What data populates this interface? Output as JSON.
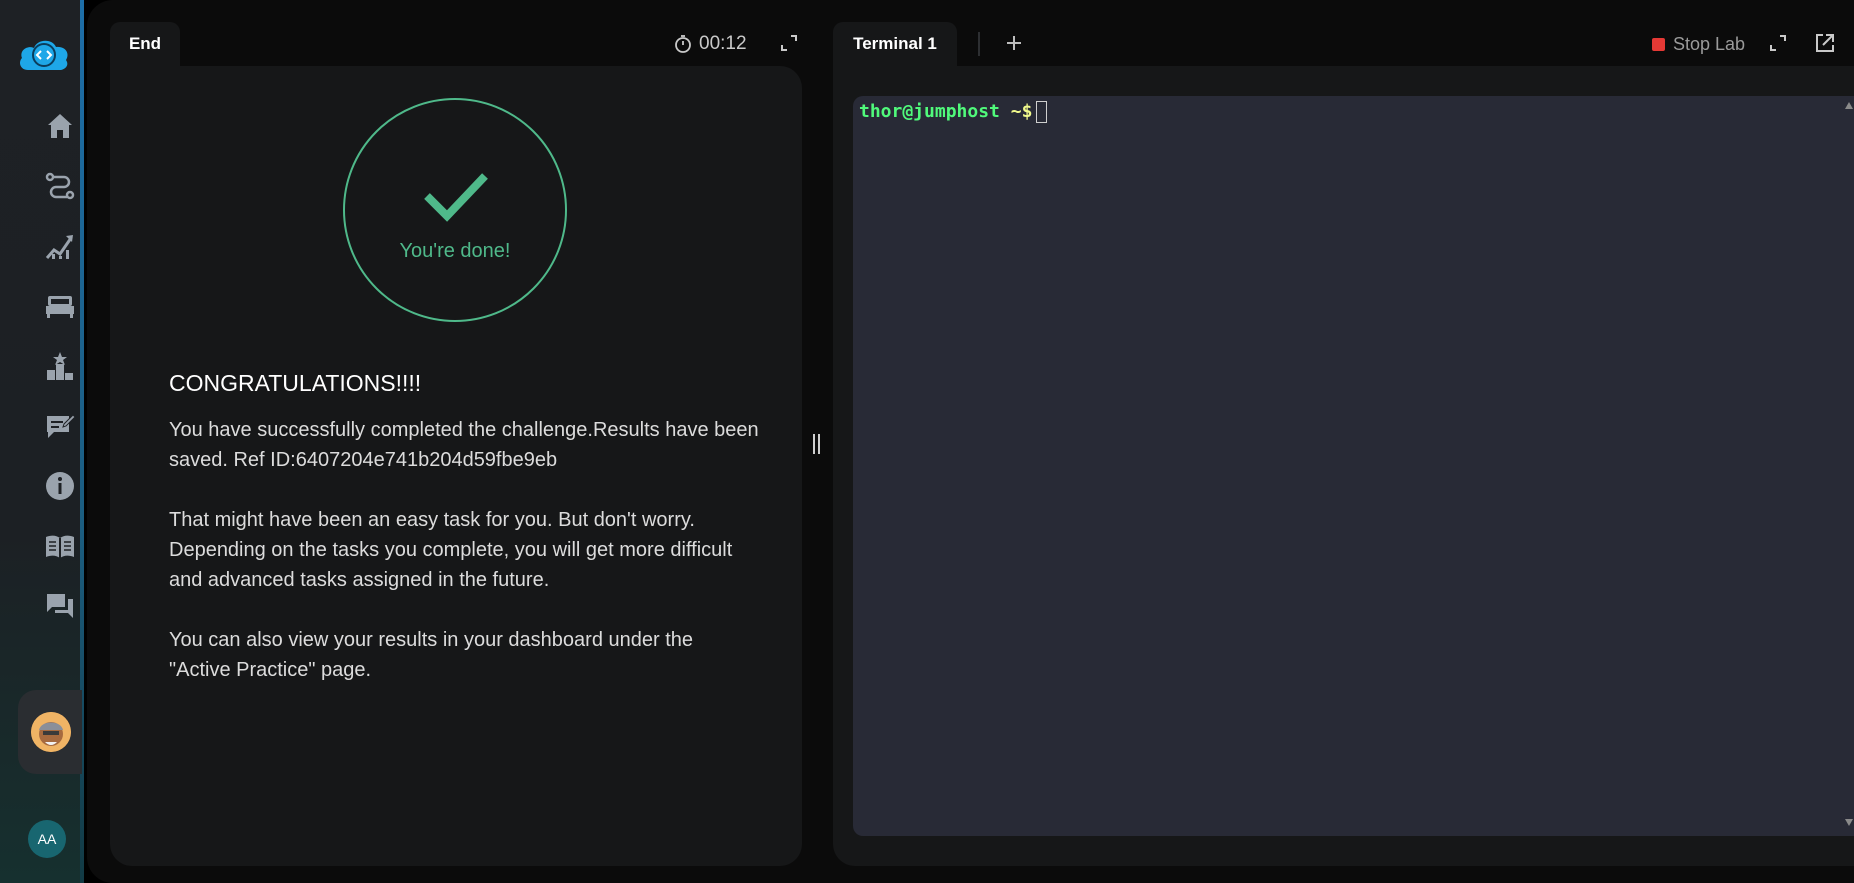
{
  "sidebar": {
    "items": [
      {
        "icon": "home-icon"
      },
      {
        "icon": "route-icon"
      },
      {
        "icon": "progress-chart-icon"
      },
      {
        "icon": "bed-icon"
      },
      {
        "icon": "leaderboard-icon"
      },
      {
        "icon": "feedback-icon"
      },
      {
        "icon": "info-icon"
      },
      {
        "icon": "book-icon"
      },
      {
        "icon": "chat-icon"
      }
    ],
    "user_initials": "AA"
  },
  "left_panel": {
    "tab_label": "End",
    "timer": "00:12",
    "done_text": "You're done!",
    "heading": "CONGRATULATIONS!!!!",
    "paragraphs": [
      "You have successfully completed the challenge.Results have been saved. Ref ID:6407204e741b204d59fbe9eb",
      "That might have been an easy task for you. But don't worry. Depending on the tasks you complete, you will get more difficult and advanced tasks assigned in the future.",
      "You can also view your results in your dashboard under the \"Active Practice\" page."
    ]
  },
  "right_panel": {
    "tab_label": "Terminal 1",
    "stop_label": "Stop Lab",
    "prompt_user": "thor@jumphost",
    "prompt_path": "~$"
  },
  "colors": {
    "success": "#4fb98a",
    "stop": "#e53935",
    "terminal_bg": "#282a36",
    "prompt_user": "#50fa7b",
    "prompt_path": "#f1fa8c"
  }
}
